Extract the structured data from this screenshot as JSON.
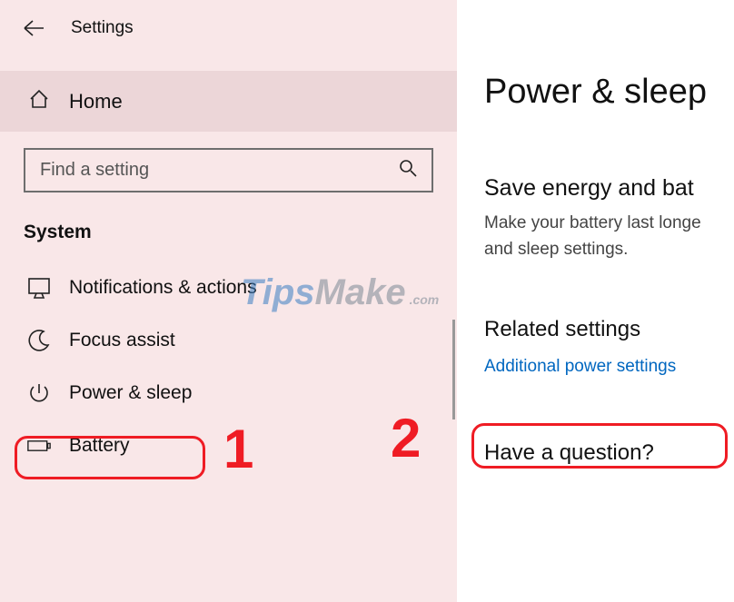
{
  "title": "Settings",
  "home_label": "Home",
  "search_placeholder": "Find a setting",
  "category": "System",
  "nav": {
    "notifications": "Notifications & actions",
    "focus": "Focus assist",
    "power": "Power & sleep",
    "battery": "Battery"
  },
  "annotations": {
    "one": "1",
    "two": "2"
  },
  "page": {
    "title": "Power & sleep",
    "save_h": "Save energy and bat",
    "save_p": "Make your battery last longe and sleep settings.",
    "related_h": "Related settings",
    "link": "Additional power settings",
    "question_h": "Have a question?"
  },
  "watermark": {
    "a": "Tips",
    "b": "Make",
    "c": ".com"
  }
}
